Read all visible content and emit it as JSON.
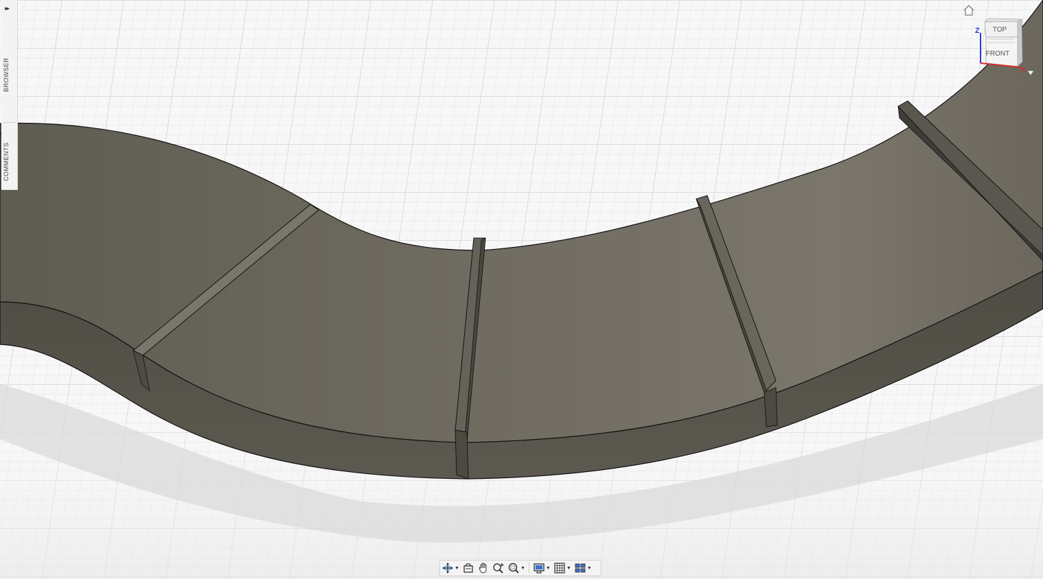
{
  "side_panel": {
    "expand_label": "▸▸",
    "tabs": [
      {
        "label": "BROWSER"
      },
      {
        "label": "COMMENTS"
      }
    ]
  },
  "viewcube": {
    "faces": {
      "top": "TOP",
      "front": "FRONT"
    },
    "axes": {
      "z": "Z",
      "x": "X"
    }
  },
  "toolbar": {
    "icons": [
      "orbit-icon",
      "look-at-icon",
      "pan-icon",
      "zoom-icon",
      "zoom-window-icon",
      "display-settings-icon",
      "grid-snaps-icon",
      "viewports-icon"
    ]
  },
  "colors": {
    "background": "#f6f6f6",
    "grid": "#d4d4d4",
    "body_top": "#6f6b60",
    "body_side": "#57544b",
    "edge": "#111111",
    "axis_z": "#2b3bd6",
    "axis_x": "#d62b2b"
  }
}
